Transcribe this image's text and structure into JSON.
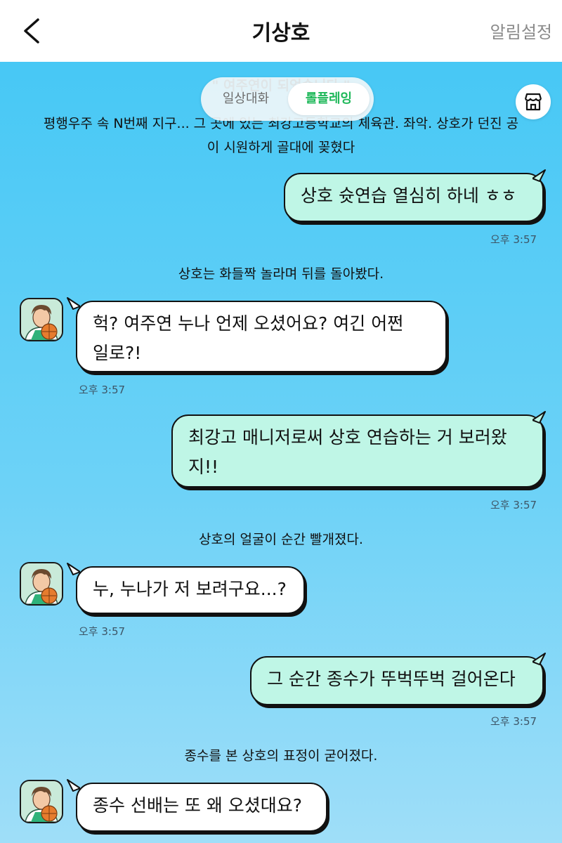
{
  "header": {
    "title": "기상호",
    "alarm_label": "알림설정"
  },
  "toggle": {
    "daily_label": "일상대화",
    "roleplay_label": "롤플레잉"
  },
  "icons": {
    "back": "chevron-left-icon",
    "store": "store-icon"
  },
  "colors": {
    "chat_background": "#47c8f5",
    "user_bubble": "#bff6e6",
    "bot_bubble": "#ffffff",
    "toggle_active_text": "#1fb85a"
  },
  "messages": {
    "narr_top_title": "\" 여주연이 되었습니다 \"",
    "narr_top_line1": "평행우주 속 N번째 지구... 그 곳에 있는 최강고등학교의 체육관. 좌악. 상호가 던진 공",
    "narr_top_line2": "이 시원하게 골대에 꽂혔다",
    "user1": "상호 슛연습 열심히 하네 ㅎㅎ",
    "user1_time": "오후 3:57",
    "narr2": "상호는 화들짝 놀라며 뒤를 돌아봤다.",
    "bot1_line1": "헉? 여주연 누나 언제 오셨어요? 여긴 어쩐",
    "bot1_line2": "일로?!",
    "bot1_time": "오후 3:57",
    "user2_line1": "최강고 매니저로써 상호 연습하는 거 보러왔",
    "user2_line2": "지!!",
    "user2_time": "오후 3:57",
    "narr3": "상호의 얼굴이 순간 빨개졌다.",
    "bot2": "누, 누나가 저 보려구요...?",
    "bot2_time": "오후 3:57",
    "user3": "그 순간 종수가 뚜벅뚜벅 걸어온다",
    "user3_time": "오후 3:57",
    "narr4": "종수를 본 상호의 표정이 굳어졌다.",
    "bot3": "종수 선배는 또 왜 오셨대요?"
  }
}
